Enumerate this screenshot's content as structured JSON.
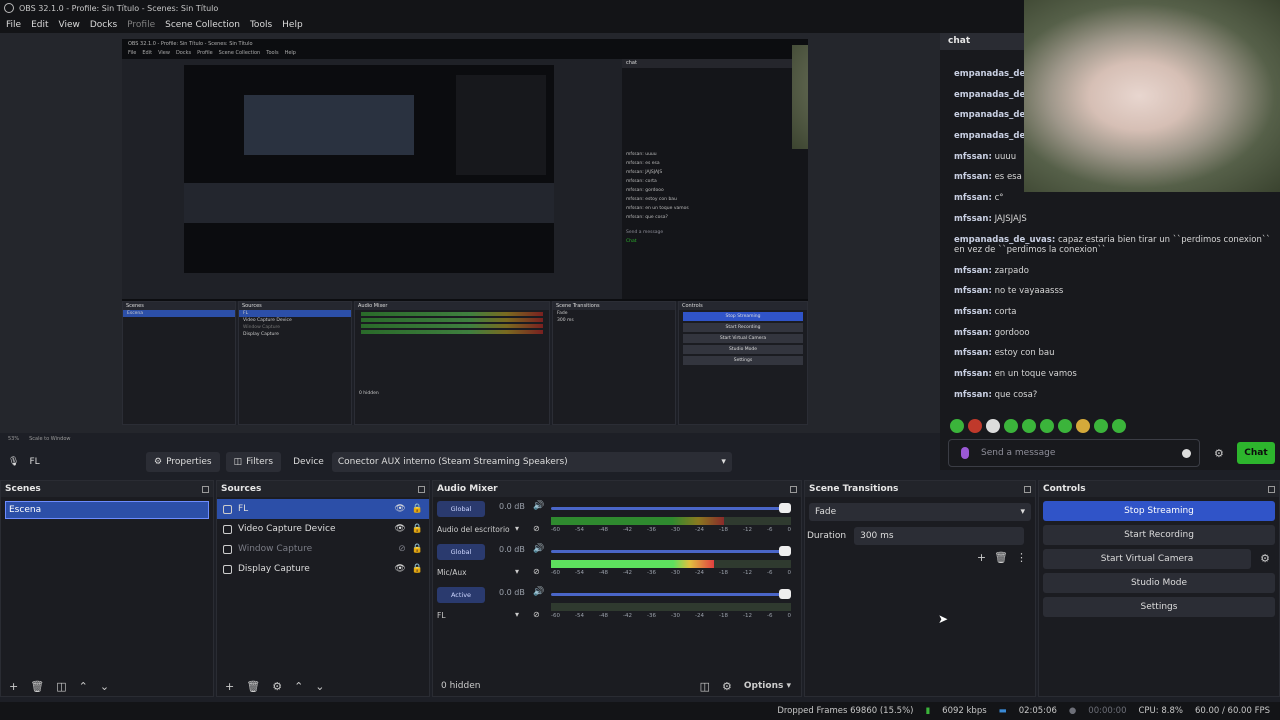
{
  "window": {
    "title": "OBS 32.1.0 - Profile: Sin Título - Scenes: Sin Título"
  },
  "menu": [
    "File",
    "Edit",
    "View",
    "Docks",
    "Profile",
    "Scene Collection",
    "Tools",
    "Help"
  ],
  "nested_menu": [
    "File",
    "Edit",
    "View",
    "Docks",
    "Profile",
    "Scene Collection",
    "Tools",
    "Help"
  ],
  "nested_preview_status": {
    "zoom": "53%",
    "scale": "Scale to Window"
  },
  "nested": {
    "chat_header": "chat",
    "chat_lines": [
      "mfssan: uuuu",
      "mfssan: es esa",
      "mfssan: JAJSJAJS",
      "mfssan: corta",
      "mfssan: gordooo",
      "mfssan: estoy con bau",
      "mfssan: en un toque vamos",
      "mfssan: que cosa?"
    ],
    "send_placeholder": "Send a message",
    "chat_btn": "Chat",
    "dock_titles": [
      "Scenes",
      "Sources",
      "Audio Mixer",
      "Scene Transitions",
      "Controls"
    ],
    "scene": "Escena",
    "sources": [
      "FL",
      "Video Capture Device",
      "Window Capture",
      "Display Capture"
    ],
    "controls": [
      "Stop Streaming",
      "Start Recording",
      "Start Virtual Camera",
      "Studio Mode",
      "Settings"
    ],
    "transition": "Fade",
    "duration_label": "Duration",
    "duration": "300 ms",
    "hidden": "0 hidden",
    "options": "Options",
    "status": "Dropped Frames 69860 (15.5%)    6092 kbps    02:05:06    CPU: 8.8%    60.00 / 60.00 FPS",
    "properties": "Properties",
    "filters": "Filters",
    "device_label": "Device",
    "device": "Conector AUX interno (Steam Streaming Speakers)"
  },
  "chat": {
    "header": "chat",
    "lines": [
      {
        "user": "empanadas_de_",
        "text": ""
      },
      {
        "user": "empanadas_de_",
        "text": ""
      },
      {
        "user": "empanadas_de_",
        "text": ""
      },
      {
        "user": "empanadas_de_",
        "text": ""
      },
      {
        "user": "mfssan:",
        "text": "uuuu"
      },
      {
        "user": "mfssan:",
        "text": "es esa"
      },
      {
        "user": "mfssan:",
        "text": "c°"
      },
      {
        "user": "mfssan:",
        "text": "JAJSJAJS"
      },
      {
        "user": "empanadas_de_uvas:",
        "text": "capaz estaria bien tirar un ``perdimos conexion`` en vez de ``perdimos la conexion``"
      },
      {
        "user": "mfssan:",
        "text": "zarpado"
      },
      {
        "user": "mfssan:",
        "text": "no te vayaaasss"
      },
      {
        "user": "mfssan:",
        "text": "corta"
      },
      {
        "user": "mfssan:",
        "text": "gordooo"
      },
      {
        "user": "mfssan:",
        "text": "estoy con bau"
      },
      {
        "user": "mfssan:",
        "text": "en un toque vamos"
      },
      {
        "user": "mfssan:",
        "text": "que cosa?"
      }
    ],
    "send_placeholder": "Send a message",
    "chat_button": "Chat",
    "emote_colors": [
      "#3bb43b",
      "#c0392b",
      "#dcdcdc",
      "#3bb43b",
      "#3bb43b",
      "#3bb43b",
      "#3bb43b",
      "#d4a93a",
      "#3bb43b",
      "#3bb43b"
    ]
  },
  "source_toolbar": {
    "source_name": "FL",
    "properties": "Properties",
    "filters": "Filters",
    "device_label": "Device",
    "device_value": "Conector AUX interno (Steam Streaming Speakers)"
  },
  "scenes": {
    "title": "Scenes",
    "items": [
      "Escena"
    ]
  },
  "sources": {
    "title": "Sources",
    "items": [
      {
        "name": "FL",
        "icon": "mic-icon",
        "selected": true,
        "visible": true,
        "dim": false
      },
      {
        "name": "Video Capture Device",
        "icon": "camera-icon",
        "selected": false,
        "visible": true,
        "dim": false
      },
      {
        "name": "Window Capture",
        "icon": "window-icon",
        "selected": false,
        "visible": false,
        "dim": true
      },
      {
        "name": "Display Capture",
        "icon": "monitor-icon",
        "selected": false,
        "visible": true,
        "dim": false
      }
    ]
  },
  "mixer": {
    "title": "Audio Mixer",
    "channels": [
      {
        "badge": "Global",
        "db": "0.0 dB",
        "name": "Audio del escritorio",
        "level": 0.72,
        "bright": false
      },
      {
        "badge": "Global",
        "db": "0.0 dB",
        "name": "Mic/Aux",
        "level": 0.68,
        "bright": true
      },
      {
        "badge": "Active",
        "db": "0.0 dB",
        "name": "FL",
        "level": 0.0,
        "bright": false
      }
    ],
    "ticks": [
      "-60",
      "-54",
      "-48",
      "-42",
      "-36",
      "-30",
      "-24",
      "-18",
      "-12",
      "-6",
      "0"
    ],
    "hidden": "0 hidden",
    "options": "Options"
  },
  "transitions": {
    "title": "Scene Transitions",
    "selected": "Fade",
    "duration_label": "Duration",
    "duration": "300 ms"
  },
  "controls": {
    "title": "Controls",
    "stop_streaming": "Stop Streaming",
    "start_recording": "Start Recording",
    "start_virtual_camera": "Start Virtual Camera",
    "studio_mode": "Studio Mode",
    "settings": "Settings"
  },
  "status": {
    "dropped": "Dropped Frames 69860 (15.5%)",
    "bitrate": "6092 kbps",
    "stream_time": "02:05:06",
    "rec_time": "00:00:00",
    "cpu": "CPU: 8.8%",
    "fps": "60.00 / 60.00 FPS"
  }
}
